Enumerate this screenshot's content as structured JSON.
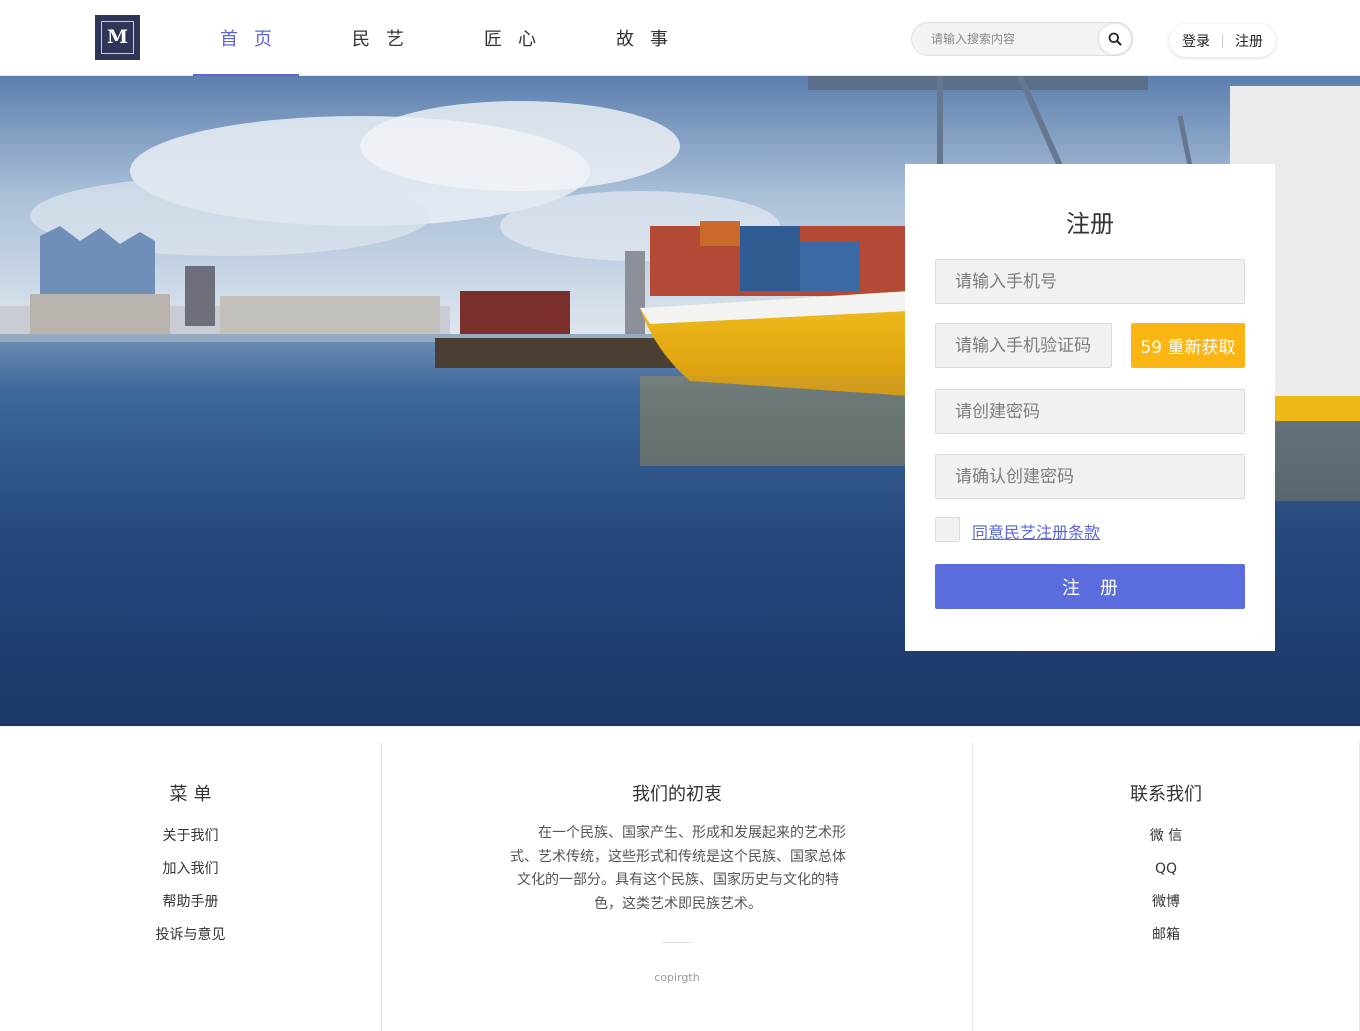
{
  "logo": {
    "letter": "M"
  },
  "nav": {
    "items": [
      {
        "label": "首页",
        "active": true
      },
      {
        "label": "民艺",
        "active": false
      },
      {
        "label": "匠心",
        "active": false
      },
      {
        "label": "故事",
        "active": false
      }
    ]
  },
  "search": {
    "placeholder": "请输入搜索内容",
    "icon": "search-icon"
  },
  "auth": {
    "login": "登录",
    "register": "注册"
  },
  "register": {
    "title": "注册",
    "phone_placeholder": "请输入手机号",
    "code_placeholder": "请输入手机验证码",
    "resend_label": "59 重新获取",
    "password_placeholder": "请创建密码",
    "confirm_placeholder": "请确认创建密码",
    "agree_label": "同意民艺注册条款",
    "submit_label": "注册"
  },
  "footer": {
    "menu": {
      "title": "菜单",
      "items": [
        "关于我们",
        "加入我们",
        "帮助手册",
        "投诉与意见"
      ]
    },
    "mission": {
      "title": "我们的初衷",
      "text": "在一个民族、国家产生、形成和发展起来的艺术形式、艺术传统，这些形式和传统是这个民族、国家总体文化的一部分。具有这个民族、国家历史与文化的特色，这类艺术即民族艺术。",
      "copyright": "copirgth"
    },
    "contact": {
      "title": "联系我们",
      "items": [
        "微 信",
        "QQ",
        "微博",
        "邮箱"
      ]
    }
  },
  "colors": {
    "accent": "#5b66d8",
    "submit": "#5b6cdc",
    "resend": "#fbb614",
    "logo_bg": "#2f3557"
  }
}
